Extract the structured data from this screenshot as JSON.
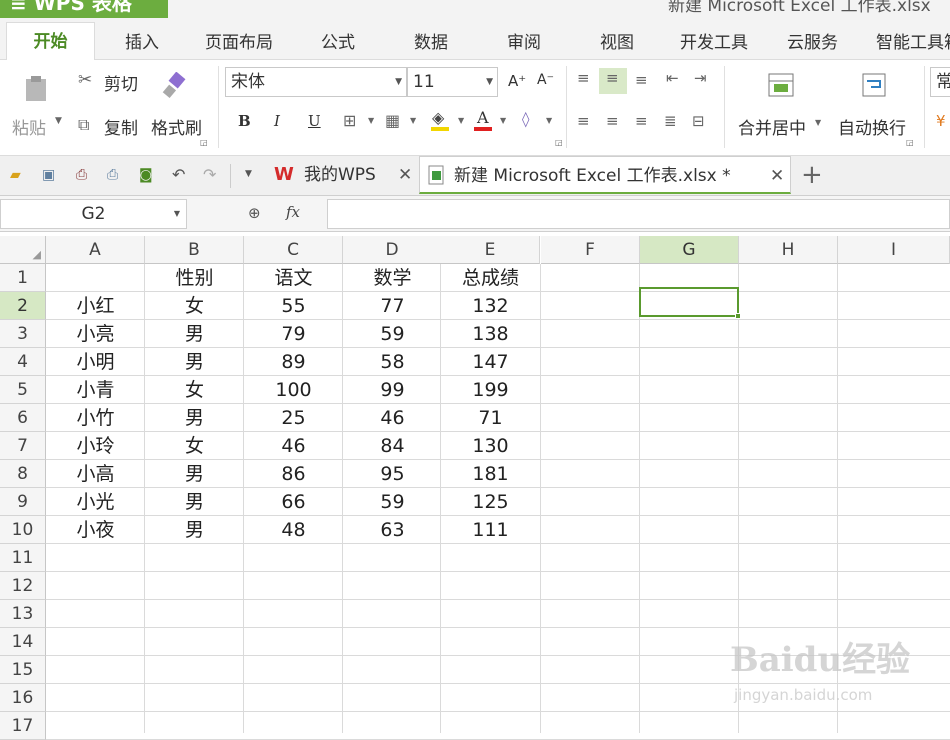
{
  "title_bar": {
    "app_name": "WPS 表格",
    "document_title": "新建 Microsoft Excel 工作表.xlsx"
  },
  "menu_tabs": [
    "开始",
    "插入",
    "页面布局",
    "公式",
    "数据",
    "审阅",
    "视图",
    "开发工具",
    "云服务",
    "智能工具箱"
  ],
  "ribbon": {
    "paste": "粘贴",
    "cut": "剪切",
    "copy": "复制",
    "format_painter": "格式刷",
    "font_name": "宋体",
    "font_size": "11",
    "bold": "B",
    "italic": "I",
    "underline": "U",
    "merge_center": "合并居中",
    "wrap_text": "自动换行",
    "number_format": "常规",
    "grow_font": "A⁺",
    "shrink_font": "A⁻"
  },
  "doc_tabs": [
    {
      "label": "我的WPS",
      "active": false
    },
    {
      "label": "新建 Microsoft Excel 工作表.xlsx *",
      "active": true
    }
  ],
  "formula_bar": {
    "cell_ref": "G2",
    "fx_label": "fx",
    "value": ""
  },
  "sheet": {
    "columns": [
      "A",
      "B",
      "C",
      "D",
      "E",
      "F",
      "G",
      "H",
      "I"
    ],
    "rows": [
      "1",
      "2",
      "3",
      "4",
      "5",
      "6",
      "7",
      "8",
      "9",
      "10",
      "11",
      "12",
      "13",
      "14",
      "15",
      "16",
      "17"
    ],
    "selected_cell": "G2",
    "headers": [
      "",
      "性别",
      "语文",
      "数学",
      "总成绩"
    ],
    "data": [
      [
        "小红",
        "女",
        "55",
        "77",
        "132"
      ],
      [
        "小亮",
        "男",
        "79",
        "59",
        "138"
      ],
      [
        "小明",
        "男",
        "89",
        "58",
        "147"
      ],
      [
        "小青",
        "女",
        "100",
        "99",
        "199"
      ],
      [
        "小竹",
        "男",
        "25",
        "46",
        "71"
      ],
      [
        "小玲",
        "女",
        "46",
        "84",
        "130"
      ],
      [
        "小高",
        "男",
        "86",
        "95",
        "181"
      ],
      [
        "小光",
        "男",
        "66",
        "59",
        "125"
      ],
      [
        "小夜",
        "男",
        "48",
        "63",
        "111"
      ]
    ]
  },
  "watermark": {
    "main": "Baidu经验",
    "sub": "jingyan.baidu.com"
  },
  "colors": {
    "accent": "#6cad3f",
    "selection": "#5a9a2e",
    "header_highlight": "#d6e8c4"
  }
}
